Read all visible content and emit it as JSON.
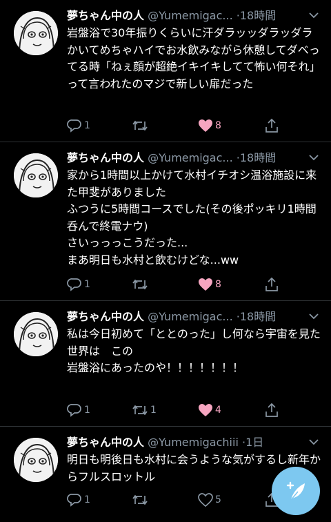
{
  "tweets": [
    {
      "name": "夢ちゃん中の人",
      "handle": "@Yumemigac...",
      "dot": "·",
      "time": "18時間",
      "text": "岩盤浴で30年振りくらいに汗ダラッッダラッダラかいてめちゃハイでお水飲みながら休憩してダベってる時「ねぇ顔が超絶イキイキしてて怖い何それ」って言われたのマジで新しい扉だった",
      "reply_count": "1",
      "retweet_count": "",
      "like_count": "8",
      "liked": true
    },
    {
      "name": "夢ちゃん中の人",
      "handle": "@Yumemigac...",
      "dot": "·",
      "time": "18時間",
      "text": "家から1時間以上かけて水村イチオシ温浴施設に来た甲斐がありました\nふつうに5時間コースでした(その後ポッキリ1時間呑んで終電ナウ)\nさいっっっこうだった...\nまあ明日も水村と飲むけどな...ww",
      "reply_count": "1",
      "retweet_count": "",
      "like_count": "8",
      "liked": true
    },
    {
      "name": "夢ちゃん中の人",
      "handle": "@Yumemigac...",
      "dot": "·",
      "time": "18時間",
      "text": "私は今日初めて「ととのった」し何なら宇宙を見た\n世界は　この\n岩盤浴にあったのや！！！！！！！",
      "reply_count": "1",
      "retweet_count": "1",
      "like_count": "4",
      "liked": true
    },
    {
      "name": "夢ちゃん中の人",
      "handle": "@Yumemigachiii",
      "dot": "·",
      "time": "1日",
      "text": "明日も明後日も水村に会うような気がするし新年からフルスロットル",
      "reply_count": "1",
      "retweet_count": "",
      "like_count": "5",
      "liked": false
    }
  ],
  "colors": {
    "background": "#000000",
    "secondary_text": "#8b98a5",
    "like_pink": "#f6a5c0",
    "compose_fab": "#7dc8f0",
    "divider": "#2f3336"
  },
  "icons": {
    "reply": "reply-icon",
    "retweet": "retweet-icon",
    "like": "heart-icon",
    "share": "share-icon",
    "more": "chevron-down-icon",
    "compose": "compose-feather-icon"
  }
}
